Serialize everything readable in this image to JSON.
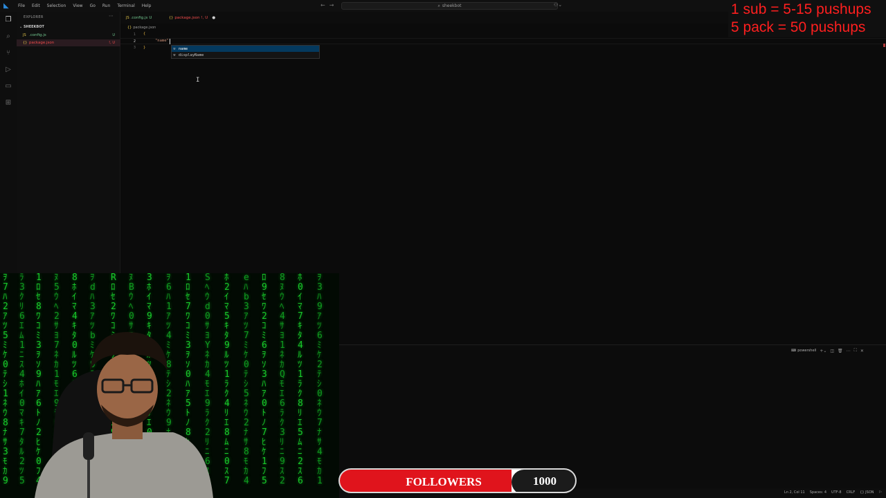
{
  "menu": [
    "File",
    "Edit",
    "Selection",
    "View",
    "Go",
    "Run",
    "Terminal",
    "Help"
  ],
  "command_center": {
    "text": "sheekbot",
    "icon": "search-icon"
  },
  "sidebar": {
    "title": "EXPLORER",
    "folder": "SHEEKBOT",
    "files": [
      {
        "name": ".config.js",
        "badge": "U",
        "color": "#73c991",
        "icon": "JS"
      },
      {
        "name": "package.json",
        "badge": "!, U",
        "color": "#f14c4c",
        "icon": "{}",
        "selected": true
      }
    ]
  },
  "tabs": [
    {
      "label": ".config.js",
      "badge": "U",
      "color": "#73c991",
      "icon": "JS"
    },
    {
      "label": "package.json",
      "badge": "!, U",
      "color": "#f14c4c",
      "icon": "{}",
      "dirty": true
    }
  ],
  "breadcrumb": {
    "icon": "{}",
    "file": "package.json"
  },
  "editor": {
    "lines": [
      "1",
      "2",
      "3"
    ],
    "open_brace": "{",
    "typed": "\"name\"",
    "close_brace": "}"
  },
  "suggestions": [
    {
      "label": "name",
      "icon": "wrench-icon"
    },
    {
      "label": "displayName",
      "icon": "wrench-icon"
    }
  ],
  "terminal": {
    "shell": "powershell"
  },
  "statusbar": [
    "Ln 2, Col 11",
    "Spaces: 4",
    "UTF-8",
    "CRLF",
    "{} JSON",
    "⚐"
  ],
  "goals": {
    "line1": "1 sub = 5-15 pushups",
    "line2": "5 pack = 50 pushups"
  },
  "followers": {
    "label": "FOLLOWERS",
    "count": "1000"
  },
  "colors": {
    "accent": "#2a88d8",
    "error": "#f14c4c",
    "untracked": "#73c991",
    "goal_red": "#ff1f1f",
    "matrix_green": "#18c92a",
    "followers_red": "#e0141c"
  }
}
